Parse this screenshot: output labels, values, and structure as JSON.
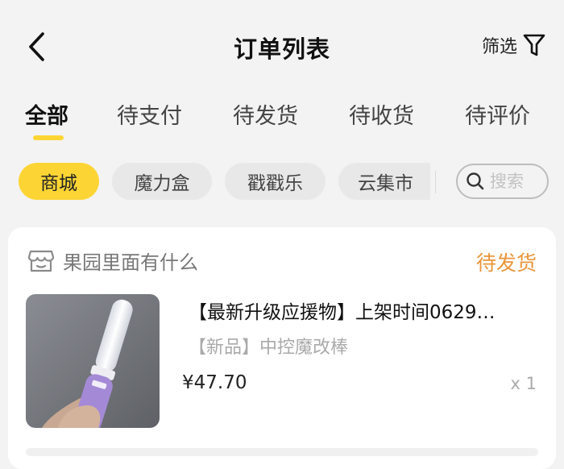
{
  "header": {
    "title": "订单列表",
    "filter_label": "筛选"
  },
  "tabs": [
    {
      "label": "全部",
      "active": true
    },
    {
      "label": "待支付",
      "active": false
    },
    {
      "label": "待发货",
      "active": false
    },
    {
      "label": "待收货",
      "active": false
    },
    {
      "label": "待评价",
      "active": false
    }
  ],
  "categories": [
    {
      "label": "商城",
      "active": true
    },
    {
      "label": "魔力盒",
      "active": false
    },
    {
      "label": "戳戳乐",
      "active": false
    },
    {
      "label": "云集市",
      "active": false
    }
  ],
  "search": {
    "placeholder": "搜索"
  },
  "order": {
    "shop_name": "果园里面有什么",
    "status": "待发货",
    "product_title": "【最新升级应援物】上架时间0629…",
    "product_subtitle": "【新品】中控魔改棒",
    "price": "¥47.70",
    "quantity": "x 1"
  },
  "colors": {
    "accent": "#fcd535",
    "status": "#e9963a",
    "background": "#f3f3f3",
    "card": "#ffffff"
  }
}
